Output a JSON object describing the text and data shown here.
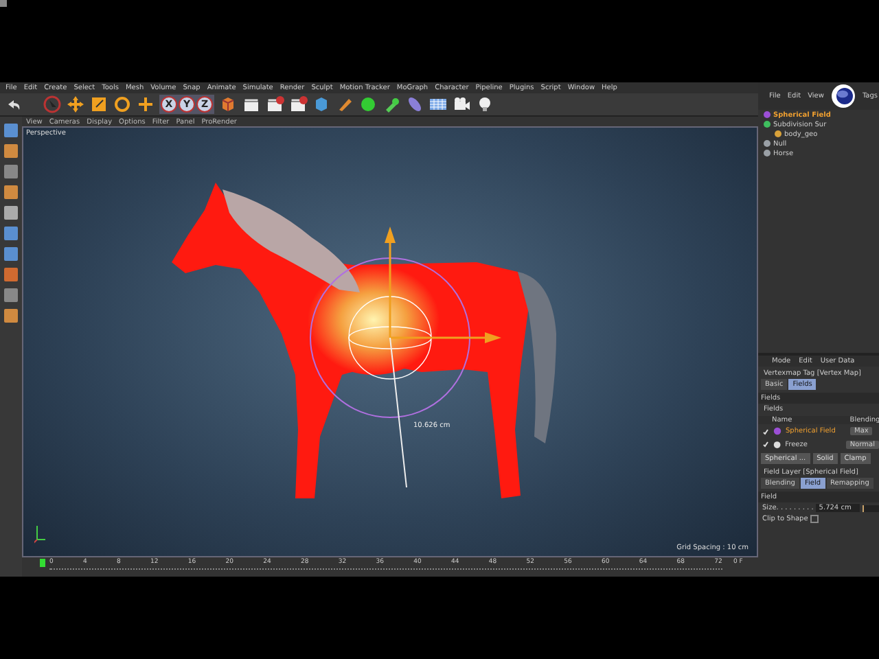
{
  "menu_bar": [
    "File",
    "Edit",
    "Create",
    "Select",
    "Tools",
    "Mesh",
    "Volume",
    "Snap",
    "Animate",
    "Simulate",
    "Render",
    "Sculpt",
    "Motion Tracker",
    "MoGraph",
    "Character",
    "Pipeline",
    "Plugins",
    "Script",
    "Window",
    "Help"
  ],
  "toolbar": {
    "axis_buttons": [
      {
        "label": "X",
        "selected": true
      },
      {
        "label": "Y",
        "selected": true
      },
      {
        "label": "Z",
        "selected": true
      }
    ]
  },
  "viewport": {
    "menu": [
      "View",
      "Cameras",
      "Display",
      "Options",
      "Filter",
      "Panel",
      "ProRender"
    ],
    "camera": "Perspective",
    "gizmo_reading": "10.626 cm",
    "grid_spacing": "Grid Spacing : 10 cm"
  },
  "timeline": {
    "ticks": [
      "0",
      "4",
      "8",
      "12",
      "16",
      "20",
      "24",
      "28",
      "32",
      "36",
      "40",
      "44",
      "48",
      "52",
      "56",
      "60",
      "64",
      "68",
      "72"
    ],
    "frame": "0 F"
  },
  "object_manager": {
    "menu": [
      "File",
      "Edit",
      "View",
      "Tags"
    ],
    "objects": [
      {
        "name": "Spherical Field",
        "selected": true,
        "color": "#9b4fd6"
      },
      {
        "name": "Subdivision Sur",
        "selected": false,
        "color": "#3fbf5f",
        "children": [
          {
            "name": "body_geo",
            "selected": false,
            "color": "#d9a23a"
          }
        ]
      },
      {
        "name": "Null",
        "selected": false,
        "color": "#9aa0a6"
      },
      {
        "name": "Horse",
        "selected": false,
        "color": "#9aa0a6"
      }
    ]
  },
  "attribute_manager": {
    "menu": [
      "Mode",
      "Edit",
      "User Data"
    ],
    "title": "Vertexmap Tag [Vertex Map]",
    "tabs": [
      {
        "label": "Basic",
        "selected": false
      },
      {
        "label": "Fields",
        "selected": true
      }
    ],
    "section": "Fields",
    "group": "Fields",
    "columns": [
      "Name",
      "Blending"
    ],
    "fields": [
      {
        "name": "Spherical Field",
        "blending": "Max",
        "enabled": true,
        "selected": true
      },
      {
        "name": "Freeze",
        "blending": "Normal",
        "enabled": true,
        "selected": false
      }
    ],
    "buttons": [
      "Spherical ...",
      "Solid",
      "Clamp"
    ],
    "layer_title": "Field Layer [Spherical Field]",
    "layer_tabs": [
      {
        "label": "Blending",
        "selected": false
      },
      {
        "label": "Field",
        "selected": true
      },
      {
        "label": "Remapping",
        "selected": false
      }
    ],
    "layer_section": "Field",
    "size_label": "Size. . . . . . . . .",
    "size_value": "5.724 cm",
    "size_slider": {
      "level": 0.1
    },
    "clip_label": "Clip to Shape",
    "clip_checked": false
  }
}
